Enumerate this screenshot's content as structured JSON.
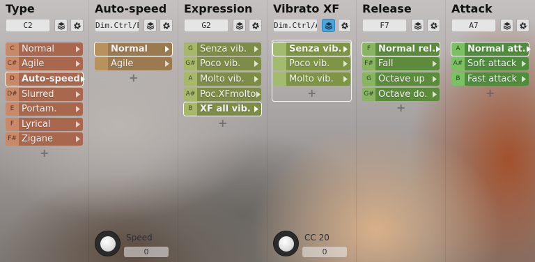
{
  "colors": {
    "type_item": "#a9684d",
    "type_key": "#c98969",
    "autospeed_item": "#9c7a50",
    "autospeed_key": "#b8925c",
    "expression_item": "#7d8c46",
    "expression_key": "#a8b86b",
    "vibrato_item": "#7d9544",
    "vibrato_key": "#a3bb6e",
    "release_item": "#5c8c3b",
    "release_key": "#89b563",
    "attack_item": "#4f8c3b",
    "attack_key": "#7cc064"
  },
  "columns": [
    {
      "title": "Type",
      "note": "C2",
      "items": [
        {
          "key": "C",
          "label": "Normal"
        },
        {
          "key": "C#",
          "label": "Agile"
        },
        {
          "key": "D",
          "label": "Auto-speed",
          "selected": true
        },
        {
          "key": "D#",
          "label": "Slurred"
        },
        {
          "key": "E",
          "label": "Portam."
        },
        {
          "key": "F",
          "label": "Lyrical"
        },
        {
          "key": "F#",
          "label": "Zigane"
        }
      ]
    },
    {
      "title": "Auto-speed",
      "note": "Dim.Ctrl/B",
      "items": [
        {
          "key": "",
          "label": "Normal",
          "selected": true
        },
        {
          "key": "",
          "label": "Agile"
        }
      ],
      "knob": {
        "label": "Speed",
        "value": "0"
      }
    },
    {
      "title": "Expression",
      "note": "G2",
      "items": [
        {
          "key": "G",
          "label": "Senza vib."
        },
        {
          "key": "G#",
          "label": "Poco vib."
        },
        {
          "key": "A",
          "label": "Molto vib."
        },
        {
          "key": "A#",
          "label": "Poc.XFmolto"
        },
        {
          "key": "B",
          "label": "XF all vib.",
          "selected": true
        }
      ]
    },
    {
      "title": "Vibrato XF",
      "note": "Dim.Ctrl/A",
      "items": [
        {
          "key": "",
          "label": "Senza vib.",
          "selected": true
        },
        {
          "key": "",
          "label": "Poco vib."
        },
        {
          "key": "",
          "label": "Molto vib."
        }
      ],
      "knob": {
        "label": "CC 20",
        "value": "0"
      }
    },
    {
      "title": "Release",
      "note": "F7",
      "items": [
        {
          "key": "F",
          "label": "Normal rel.",
          "selected": true
        },
        {
          "key": "F#",
          "label": "Fall"
        },
        {
          "key": "G",
          "label": "Octave up"
        },
        {
          "key": "G#",
          "label": "Octave do."
        }
      ]
    },
    {
      "title": "Attack",
      "note": "A7",
      "items": [
        {
          "key": "A",
          "label": "Normal att.",
          "selected": true
        },
        {
          "key": "A#",
          "label": "Soft attack"
        },
        {
          "key": "B",
          "label": "Fast attack"
        }
      ]
    }
  ]
}
